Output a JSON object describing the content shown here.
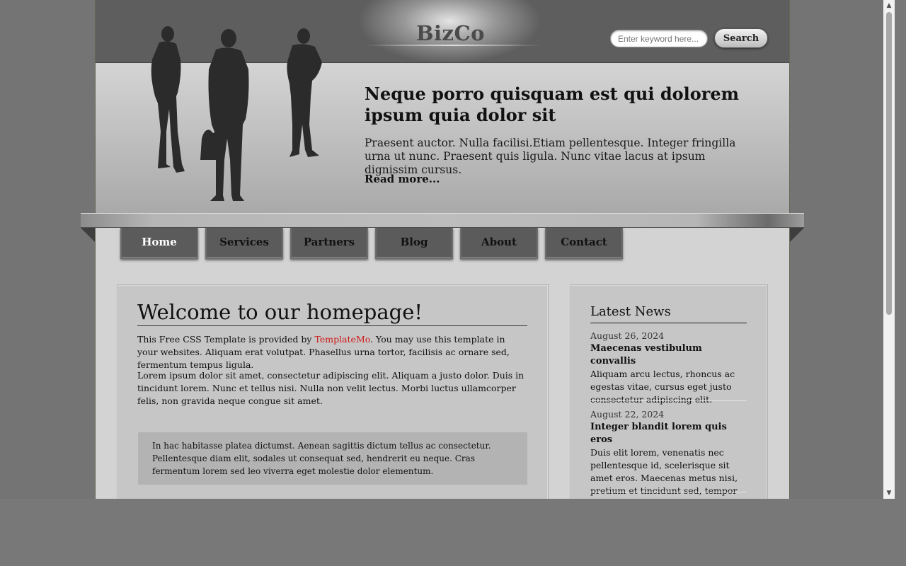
{
  "header": {
    "logo": "BizCo",
    "search": {
      "placeholder": "Enter keyword here...",
      "button_label": "Search"
    }
  },
  "banner": {
    "title": "Neque porro quisquam est qui dolorem ipsum quia dolor sit",
    "text": "Praesent auctor. Nulla facilisi.Etiam pellentesque. Integer fringilla urna ut nunc. Praesent quis ligula. Nunc vitae lacus at ipsum dignissim cursus.",
    "link": "Read more..."
  },
  "nav": {
    "items": [
      {
        "label": "Home",
        "active": true
      },
      {
        "label": "Services"
      },
      {
        "label": "Partners"
      },
      {
        "label": "Blog"
      },
      {
        "label": "About"
      },
      {
        "label": "Contact"
      }
    ]
  },
  "main": {
    "title": "Welcome to our homepage!",
    "intro_before": "This Free CSS Template is provided by ",
    "intro_link": "TemplateMo",
    "intro_after": ". You may use this template in your websites. Aliquam erat volutpat. Phasellus urna tortor, facilisis ac ornare sed, fermentum tempus ligula.",
    "para2": "Lorem ipsum dolor sit amet, consectetur adipiscing elit. Aliquam a justo dolor. Duis in tincidunt lorem. Nunc et tellus nisi. Nulla non velit lectus. Morbi luctus ullamcorper felis, non gravida neque congue sit amet.",
    "quote": "In hac habitasse platea dictumst. Aenean sagittis dictum tellus ac consectetur. Pellentesque diam elit, sodales ut consequat sed, hendrerit eu neque. Cras fermentum lorem sed leo viverra eget molestie dolor elementum."
  },
  "sidebar": {
    "title": "Latest News",
    "news": [
      {
        "date": "August 26, 2024",
        "headline": "Maecenas vestibulum convallis",
        "body": "Aliquam arcu lectus, rhoncus ac egestas vitae, cursus eget justo consectetur adipiscing elit."
      },
      {
        "date": "August 22, 2024",
        "headline": "Integer blandit lorem quis eros",
        "body": "Duis elit lorem, venenatis nec pellentesque id, scelerisque sit amet eros. Maecenas metus nisi, pretium et tincidunt sed, tempor non elit."
      }
    ]
  },
  "icons": {
    "scroll_up": "scroll-up-arrow-icon",
    "scroll_down": "scroll-down-arrow-icon",
    "banner_image": "business-people-silhouette-icon"
  }
}
